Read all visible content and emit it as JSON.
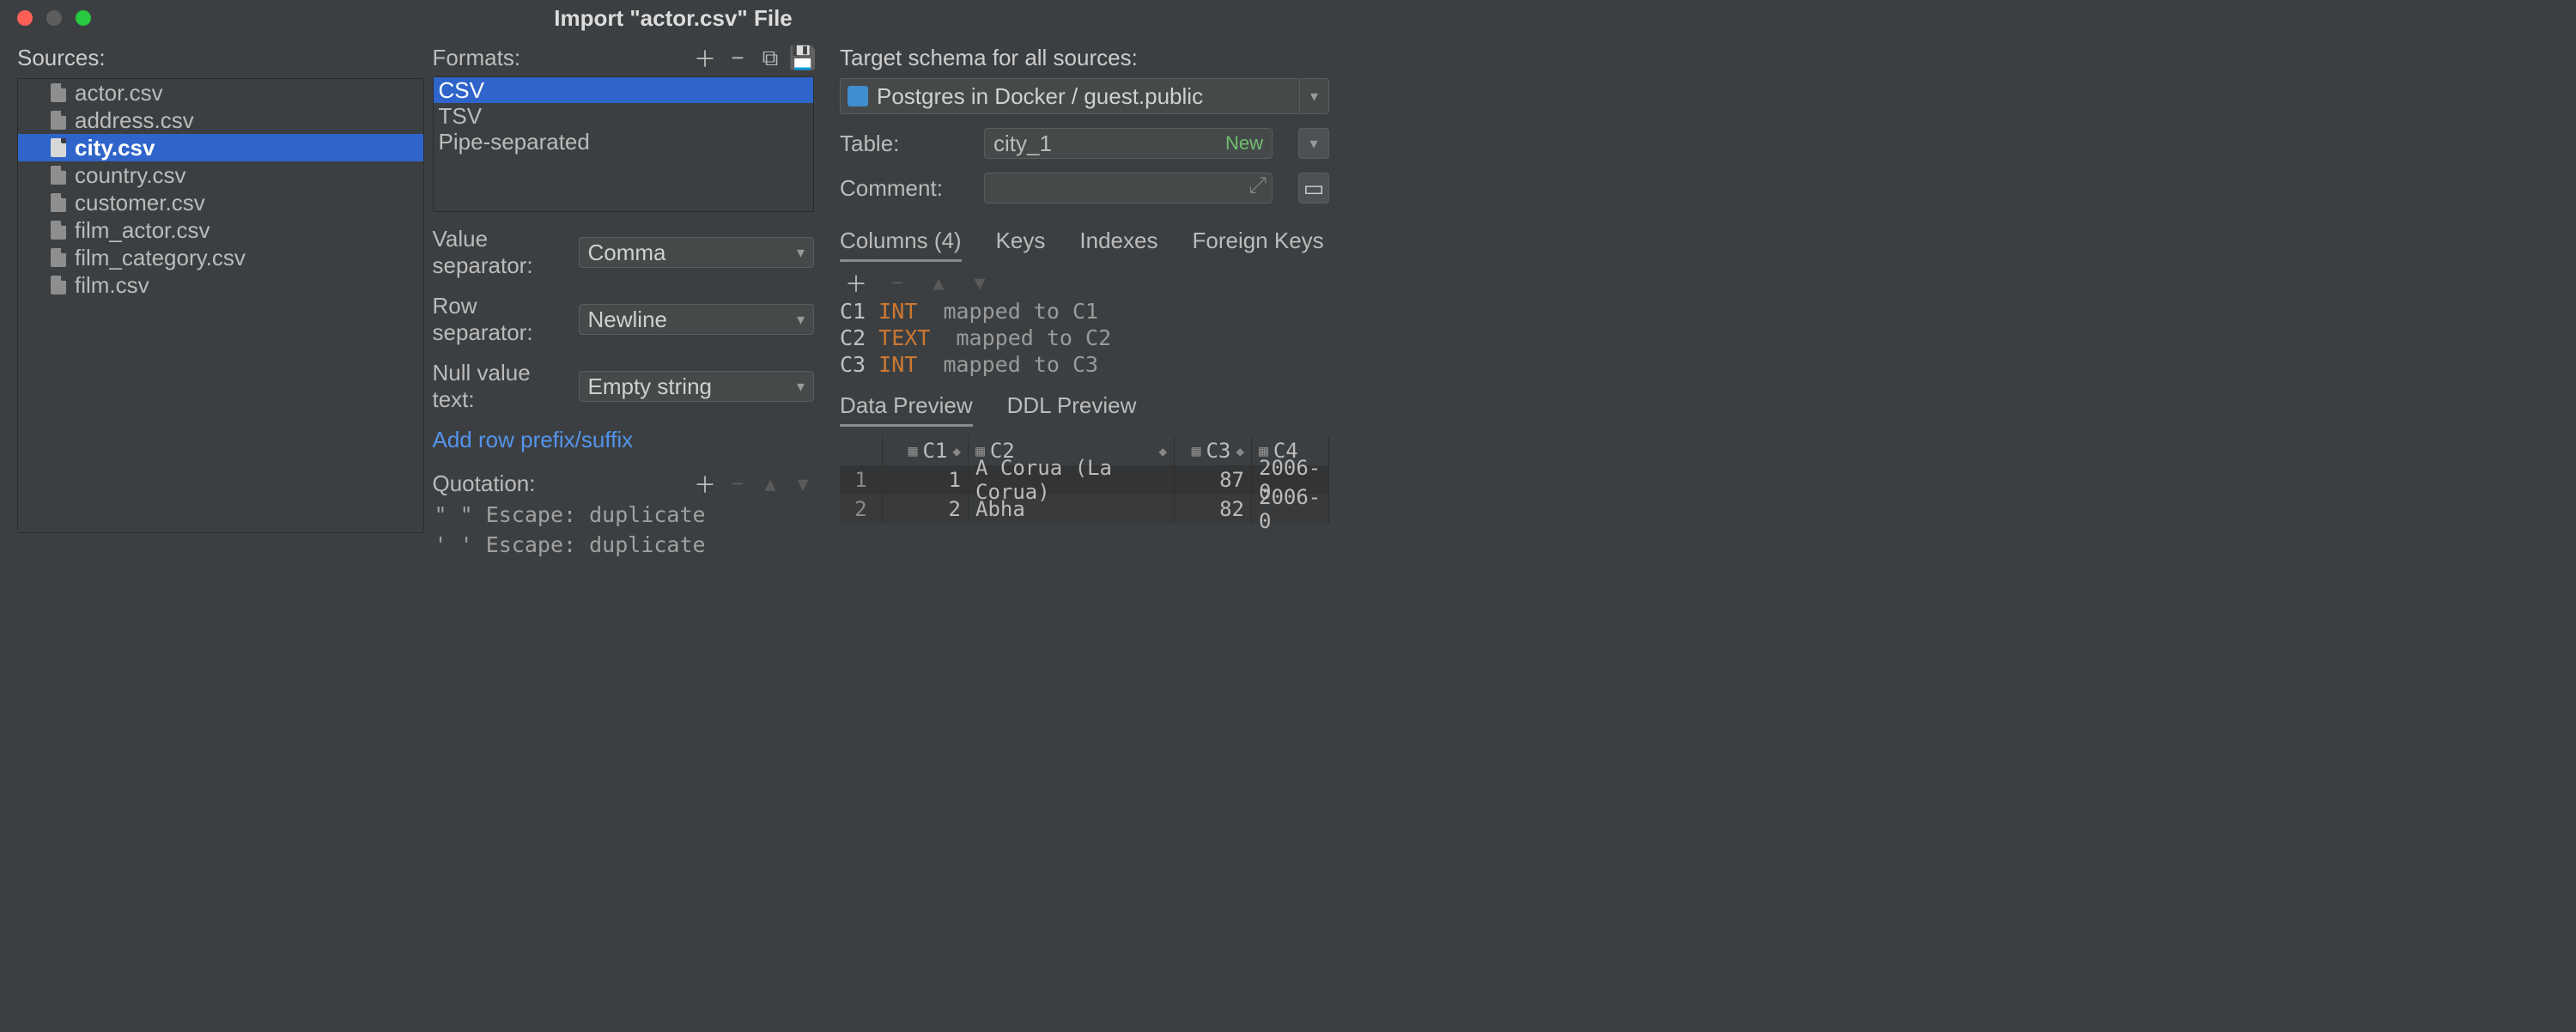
{
  "window": {
    "title": "Import \"actor.csv\" File"
  },
  "sources": {
    "label": "Sources:",
    "items": [
      {
        "name": "actor.csv"
      },
      {
        "name": "address.csv"
      },
      {
        "name": "city.csv"
      },
      {
        "name": "country.csv"
      },
      {
        "name": "customer.csv"
      },
      {
        "name": "film_actor.csv"
      },
      {
        "name": "film_category.csv"
      },
      {
        "name": "film.csv"
      }
    ],
    "selected": "city.csv"
  },
  "formats": {
    "label": "Formats:",
    "items": [
      "CSV",
      "TSV",
      "Pipe-separated"
    ],
    "selected": "CSV",
    "value_sep": {
      "label": "Value separator:",
      "value": "Comma"
    },
    "row_sep": {
      "label": "Row separator:",
      "value": "Newline"
    },
    "null_text": {
      "label": "Null value text:",
      "value": "Empty string"
    },
    "add_prefix": "Add row prefix/suffix",
    "quotation": {
      "label": "Quotation:",
      "rows": [
        "\" \"  Escape: duplicate",
        "' '  Escape: duplicate"
      ]
    }
  },
  "target": {
    "schema_label": "Target schema for all sources:",
    "schema_value": "Postgres in Docker / guest.public",
    "table_label": "Table:",
    "table_value": "city_1",
    "table_badge": "New",
    "comment_label": "Comment:",
    "comment_value": "",
    "tabs": [
      "Columns (4)",
      "Keys",
      "Indexes",
      "Foreign Keys"
    ],
    "active_tab": "Columns (4)",
    "columns": [
      {
        "name": "C1",
        "type": "INT",
        "map": "mapped to C1"
      },
      {
        "name": "C2",
        "type": "TEXT",
        "map": "mapped to C2"
      },
      {
        "name": "C3",
        "type": "INT",
        "map": "mapped to C3"
      }
    ],
    "preview_tabs": [
      "Data Preview",
      "DDL Preview"
    ],
    "preview_active": "Data Preview",
    "preview": {
      "headers": [
        "C1",
        "C2",
        "C3",
        "C4"
      ],
      "rows": [
        {
          "n": "1",
          "c1": "1",
          "c2": "A Corua (La Corua)",
          "c3": "87",
          "c4": "2006-0"
        },
        {
          "n": "2",
          "c1": "2",
          "c2": "Abha",
          "c3": "82",
          "c4": "2006-0"
        }
      ]
    }
  }
}
